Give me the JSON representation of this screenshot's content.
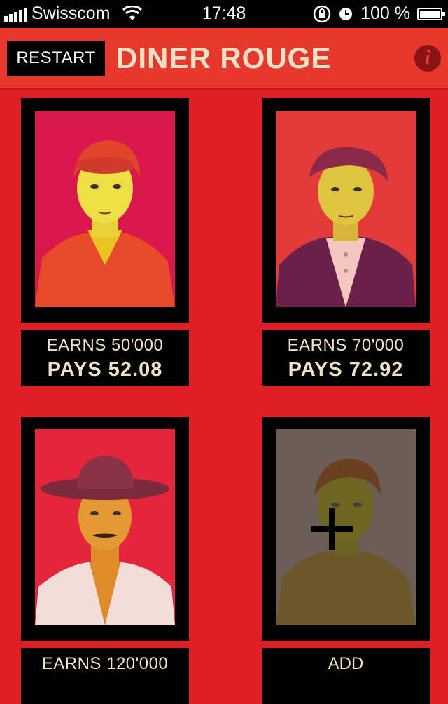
{
  "status_bar": {
    "carrier": "Swisscom",
    "time": "17:48",
    "battery_text": "100 %"
  },
  "header": {
    "restart_label": "RESTART",
    "title": "DINER ROUGE",
    "info_icon": "i"
  },
  "people": [
    {
      "earns": "EARNS 50'000",
      "pays": "PAYS 52.08"
    },
    {
      "earns": "EARNS 70'000",
      "pays": "PAYS 72.92"
    },
    {
      "earns": "EARNS 120'000",
      "pays": ""
    }
  ],
  "add_card": {
    "label": "ADD"
  },
  "colors": {
    "background": "#e01f25",
    "navbar": "#e8382e",
    "title_text": "#f0e2c7",
    "card_frame": "#000000"
  }
}
